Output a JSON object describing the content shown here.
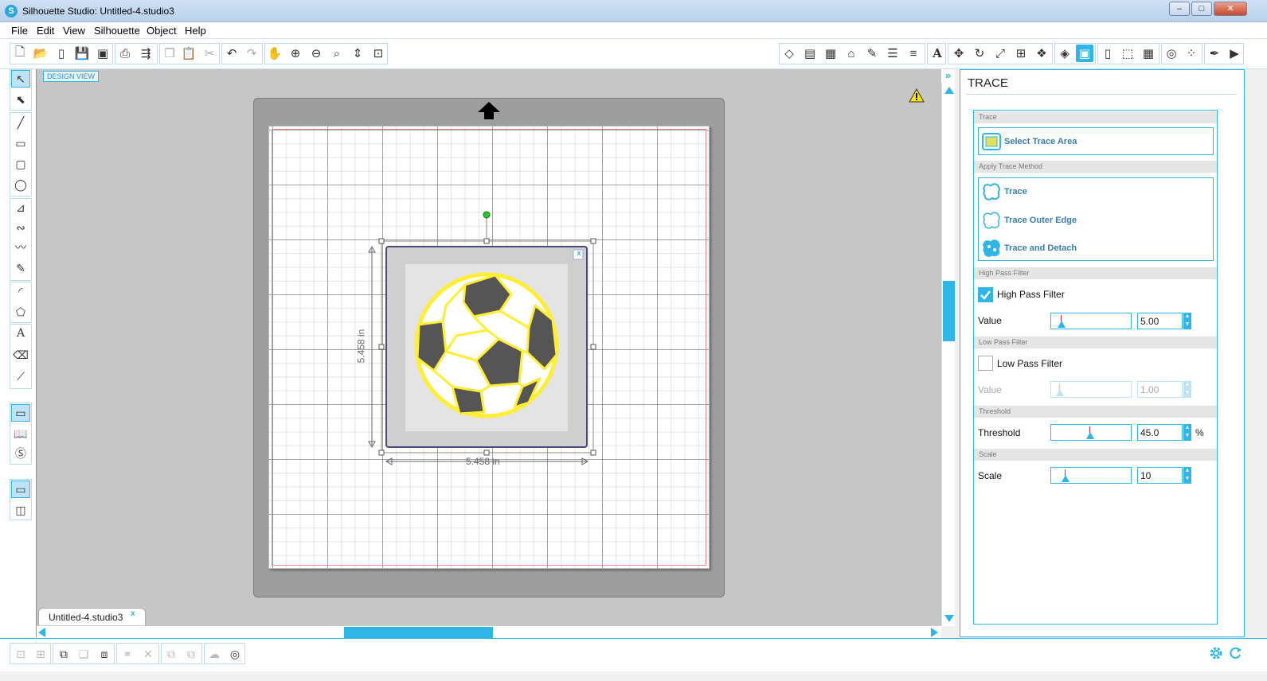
{
  "window": {
    "title": "Silhouette Studio: Untitled-4.studio3",
    "min": "–",
    "max": "□",
    "close": "✕"
  },
  "menu": [
    "File",
    "Edit",
    "View",
    "Silhouette",
    "Object",
    "Help"
  ],
  "canvas": {
    "view_tag": "DESIGN VIEW",
    "width_label": "5.458 in",
    "height_label": "5.458 in",
    "close_glyph": "x"
  },
  "tab": {
    "label": "Untitled-4.studio3",
    "close": "x"
  },
  "panel": {
    "title": "TRACE",
    "sections": {
      "trace": "Trace",
      "apply": "Apply Trace Method",
      "high_pass": "High Pass Filter",
      "low_pass": "Low Pass Filter",
      "threshold": "Threshold",
      "scale": "Scale"
    },
    "select_trace_area": "Select Trace Area",
    "methods": [
      "Trace",
      "Trace Outer Edge",
      "Trace and Detach"
    ],
    "high_pass": {
      "label": "High Pass Filter",
      "checked": true,
      "value_label": "Value",
      "value": "5.00",
      "level": 0.05
    },
    "low_pass": {
      "label": "Low Pass Filter",
      "checked": false,
      "value_label": "Value",
      "value": "1.00",
      "level": 0.02
    },
    "threshold": {
      "label": "Threshold",
      "value": "45.0",
      "unit": "%",
      "level": 0.45
    },
    "scale": {
      "label": "Scale",
      "value": "10",
      "level": 0.1
    }
  },
  "colors": {
    "accent": "#2fb5e6",
    "trace_yellow": "#ffee33",
    "ball_dark": "#555555"
  },
  "icons": {
    "warning": "warning-icon",
    "mat_arrow": "mat-feed-arrow-icon",
    "settings": "gear-icon",
    "refresh": "refresh-icon"
  }
}
